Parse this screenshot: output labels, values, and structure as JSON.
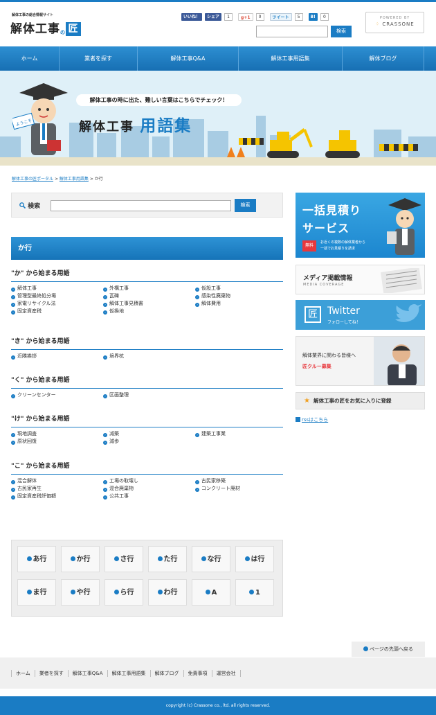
{
  "site": {
    "logo_sub": "解体工事の総合情報サイト",
    "logo_main": "解体工事",
    "logo_no": "の",
    "logo_mark": "匠",
    "powered_label": "POWERED BY",
    "powered_name": "CRASSONE"
  },
  "social": {
    "fb_label": "いいね！",
    "share_label": "シェア",
    "share_count": "1",
    "gplus_label": "g+1",
    "gplus_count": "0",
    "tweet_label": "ツイート",
    "tweet_count": "5",
    "hatena_label": "B!",
    "hatena_count": "0"
  },
  "header_search": {
    "button": "検索",
    "value": ""
  },
  "nav": {
    "items": [
      "ホーム",
      "業者を探す",
      "解体工事Q&A",
      "解体工事用語集",
      "解体ブログ"
    ]
  },
  "banner": {
    "speech": "解体工事の時に出た、難しい言葉はこちらでチェック！",
    "title_a": "解体工事",
    "title_b": "用語集",
    "sign": "ようこそ"
  },
  "breadcrumb": {
    "link1": "解体工事の匠ポータル",
    "sep": ">",
    "link2": "解体工事用語集",
    "current": "か行"
  },
  "search": {
    "label": "検索",
    "button": "検索",
    "value": ""
  },
  "section": {
    "title": "か行"
  },
  "groups": [
    {
      "title": "\"か\" から始まる用語",
      "terms": [
        "解体工事",
        "外構工事",
        "仮設工事",
        "管理型最終処分場",
        "瓦礫",
        "感染性廃棄物",
        "家電リサイクル法",
        "解体工事見積書",
        "解体費用",
        "固定資産税",
        "仮換地"
      ]
    },
    {
      "title": "\"き\" から始まる用語",
      "terms": [
        "近隣挨拶",
        "境界杭"
      ]
    },
    {
      "title": "\"く\" から始まる用語",
      "terms": [
        "クリーンセンター",
        "区画整理"
      ]
    },
    {
      "title": "\"け\" から始まる用語",
      "terms": [
        "現地調査",
        "减築",
        "建築工事業",
        "原状回復",
        "減歩"
      ]
    },
    {
      "title": "\"こ\" から始まる用語",
      "terms": [
        "混合解体",
        "工場の取壊し",
        "古民家移築",
        "古民家再生",
        "混合廃棄物",
        "コンクリート廃材",
        "固定資産税評価額",
        "公共工事"
      ]
    }
  ],
  "kana": [
    "あ行",
    "か行",
    "さ行",
    "た行",
    "な行",
    "は行",
    "ま行",
    "や行",
    "ら行",
    "わ行",
    "A",
    "1"
  ],
  "sidebar": {
    "estimate_1": "一括見積り",
    "estimate_2": "サービス",
    "estimate_badge": "無料",
    "estimate_text_1": "お近くの複数の解体業者から",
    "estimate_text_2": "一括でお見積りを請求",
    "media_title": "メディア掲載情報",
    "media_sub": "MEDIA COVERAGE",
    "twitter_title": "Twitter",
    "twitter_sub": "フォローしてね！",
    "twitter_mark": "匠",
    "crew_1": "解体業界に関わる皆様へ",
    "crew_2": "匠クルー募集",
    "favorite": "解体工事の匠をお気に入りに登録",
    "rss": "rssはこちら"
  },
  "totop": "ページの先頭へ戻る",
  "footer_nav": [
    "ホーム",
    "業者を探す",
    "解体工事Q&A",
    "解体工事用語集",
    "解体ブログ",
    "免責事項",
    "運営会社"
  ],
  "copyright": "copyright (c) Crassone co., ltd. all rights reserved.",
  "colors": {
    "primary": "#1a7cc4",
    "accent": "#e8383d"
  }
}
